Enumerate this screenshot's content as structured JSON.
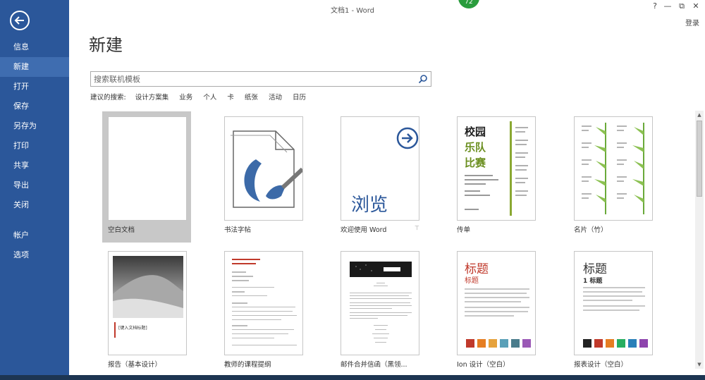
{
  "window": {
    "title": "文档1 - Word",
    "badge": "72",
    "help": "?",
    "minimize": "—",
    "restore": "⧉",
    "close": "✕",
    "login": "登录"
  },
  "sidebar": {
    "items": [
      {
        "label": "信息"
      },
      {
        "label": "新建"
      },
      {
        "label": "打开"
      },
      {
        "label": "保存"
      },
      {
        "label": "另存为"
      },
      {
        "label": "打印"
      },
      {
        "label": "共享"
      },
      {
        "label": "导出"
      },
      {
        "label": "关闭"
      },
      {
        "label": "帐户"
      },
      {
        "label": "选项"
      }
    ]
  },
  "main": {
    "title": "新建",
    "search_placeholder": "搜索联机模板",
    "suggest_label": "建议的搜索:",
    "suggestions": [
      "设计方案集",
      "业务",
      "个人",
      "卡",
      "纸张",
      "活动",
      "日历"
    ]
  },
  "templates": [
    {
      "label": "空白文档"
    },
    {
      "label": "书法字帖"
    },
    {
      "label": "欢迎使用 Word",
      "thumb_text": "浏览"
    },
    {
      "label": "传单",
      "thumb_text": [
        "校园",
        "乐队",
        "比赛"
      ]
    },
    {
      "label": "名片（竹）"
    },
    {
      "label": "报告（基本设计）",
      "thumb_text": "[键入文档标题]"
    },
    {
      "label": "教师的课程提纲"
    },
    {
      "label": "邮件合并信函（黑领..."
    },
    {
      "label": "Ion 设计（空白）",
      "thumb_text": [
        "标题",
        "标题"
      ]
    },
    {
      "label": "报表设计（空白）",
      "thumb_text": [
        "标题",
        "1  标题"
      ]
    }
  ],
  "colors": {
    "sidebar_bg": "#2b579a",
    "sidebar_active": "#3f6db0",
    "accent_red": "#c0392b"
  }
}
